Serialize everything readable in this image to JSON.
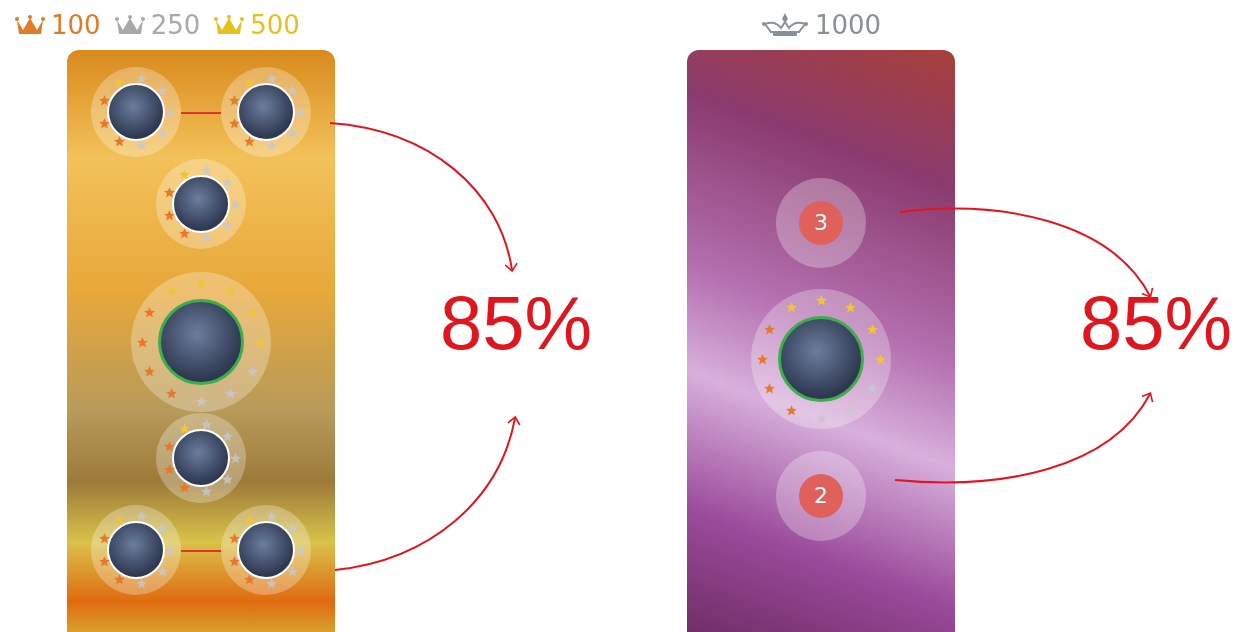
{
  "panels": [
    {
      "tiers": [
        {
          "kind": "crown",
          "label": "100",
          "color": "#e07b28"
        },
        {
          "kind": "crown",
          "label": "250",
          "color": "#a9a9a9"
        },
        {
          "kind": "crown",
          "label": "500",
          "color": "#e6c11e"
        }
      ],
      "rows": [
        {
          "kind": "pair",
          "avatars": [
            {
              "kind": "small"
            },
            {
              "kind": "small"
            }
          ]
        },
        {
          "kind": "single",
          "avatars": [
            {
              "kind": "small"
            }
          ]
        },
        {
          "kind": "single",
          "avatars": [
            {
              "kind": "large"
            }
          ]
        },
        {
          "kind": "single",
          "avatars": [
            {
              "kind": "small"
            }
          ]
        },
        {
          "kind": "pair",
          "avatars": [
            {
              "kind": "small"
            },
            {
              "kind": "small"
            }
          ]
        }
      ],
      "result": "85%"
    },
    {
      "tiers": [
        {
          "kind": "royal",
          "label": "1000",
          "color": "#8a9098"
        }
      ],
      "rows": [
        {
          "kind": "badge",
          "label": "3"
        },
        {
          "kind": "single",
          "avatars": [
            {
              "kind": "large"
            }
          ]
        },
        {
          "kind": "badge",
          "label": "2"
        }
      ],
      "result": "85%"
    }
  ]
}
